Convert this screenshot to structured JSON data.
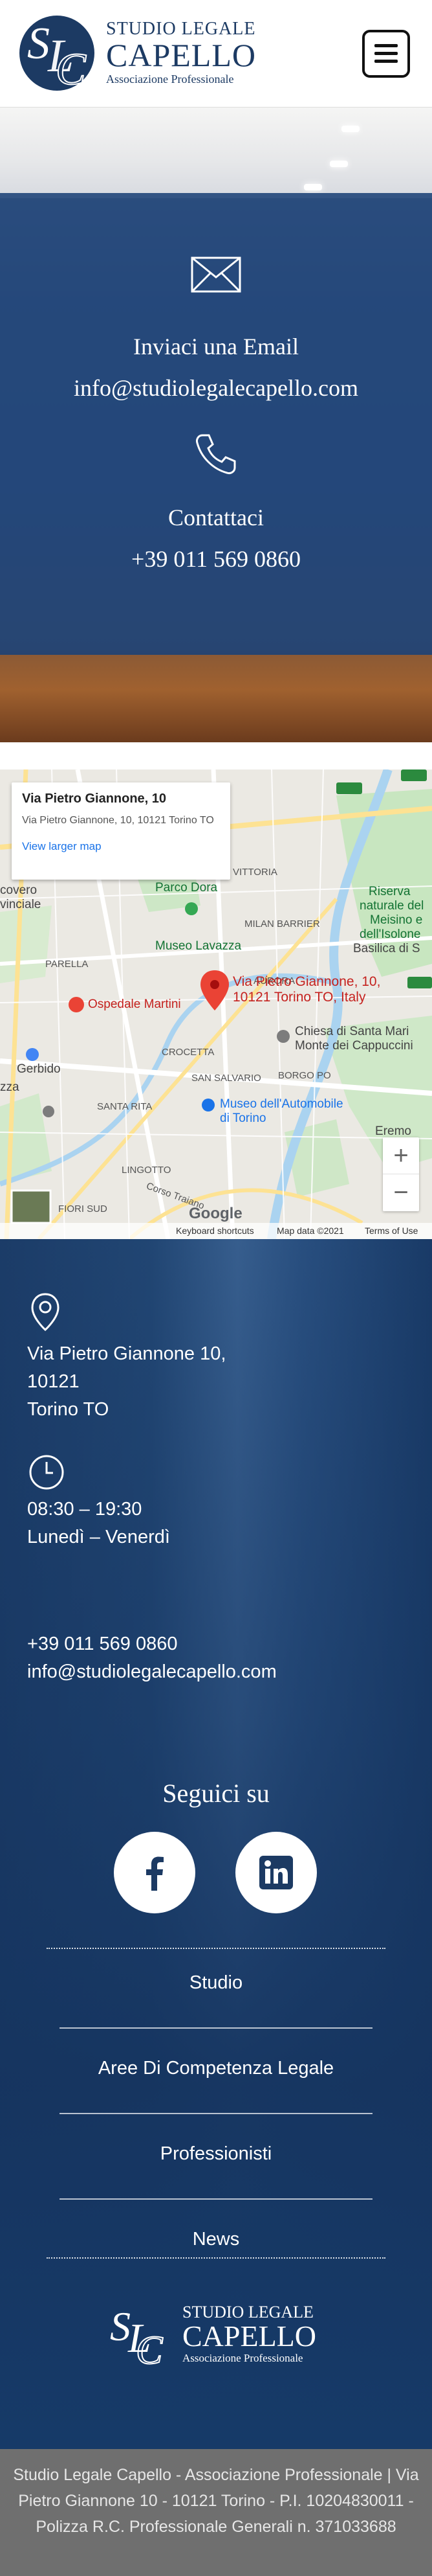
{
  "header": {
    "logo": {
      "line1": "STUDIO LEGALE",
      "line2": "CAPELLO",
      "line3": "Associazione Professionale"
    },
    "menu_icon": "hamburger-icon"
  },
  "contact": {
    "email_title": "Inviaci una Email",
    "email_value": "info@studiolegalecapello.com",
    "phone_title": "Contattaci",
    "phone_value": "+39 011 569 0860"
  },
  "map": {
    "info_title": "Via Pietro Giannone, 10",
    "info_address": "Via Pietro Giannone, 10, 10121 Torino TO",
    "info_link": "View larger map",
    "marker_label_1": "Via Pietro Giannone, 10,",
    "marker_label_2": "10121 Torino TO, Italy",
    "labels": {
      "parco_dora": "Parco Dora",
      "museo_lavazza": "Museo Lavazza",
      "ospedale": "Ospedale Martini",
      "parella": "PARELLA",
      "chiesa_1": "Chiesa di Santa Mari",
      "chiesa_2": "Monte dei Cappuccini",
      "museo_auto_1": "Museo dell'Automobile",
      "museo_auto_2": "di Torino",
      "riserva_1": "Riserva",
      "riserva_2": "naturale del",
      "riserva_3": "Meisino e",
      "riserva_4": "dell'Isolone",
      "basilica": "Basilica di S",
      "covero_1": "covero",
      "covero_2": "vinciale",
      "gerbido": "Gerbido",
      "zza": "zza",
      "milan_barrier": "MILAN BARRIER",
      "vittoria": "VITTORIA",
      "aurora": "AURORA",
      "crocetta": "CROCETTA",
      "san_salvario": "SAN SALVARIO",
      "borgo_po": "BORGO PO",
      "lingotto": "LINGOTTO",
      "santa_rita": "SANTA RITA",
      "mirafiori": "FIORI SUD",
      "corso": "Corso Traiano",
      "eremo": "Eremo"
    },
    "zoom_in": "+",
    "zoom_out": "−",
    "google": "Google",
    "footer_shortcuts": "Keyboard shortcuts",
    "footer_data": "Map data ©2021",
    "footer_terms": "Terms of Use"
  },
  "info": {
    "address_line1": "Via Pietro Giannone 10,",
    "address_line2": "10121",
    "address_line3": "Torino TO",
    "hours_line1": "08:30 – 19:30",
    "hours_line2": "Lunedì – Venerdì",
    "phone": "+39 011 569 0860",
    "email": "info@studiolegalecapello.com",
    "social_title": "Seguici su",
    "social_icons": [
      "facebook-icon",
      "linkedin-icon"
    ]
  },
  "nav": {
    "items": [
      "Studio",
      "Aree Di Competenza Legale",
      "Professionisti",
      "News"
    ]
  },
  "footer_logo": {
    "line1": "STUDIO LEGALE",
    "line2": "CAPELLO",
    "line3": "Associazione Professionale"
  },
  "bottom": {
    "text": "Studio Legale Capello - Associazione Professionale | Via Pietro Giannone 10 - 10121 Torino - P.I. 10204830011 - Polizza R.C. Professionale Generali n. 371033688"
  },
  "colors": {
    "brand": "#1c3a63",
    "panel": "#173e74",
    "bottom": "#6f6f6f"
  }
}
